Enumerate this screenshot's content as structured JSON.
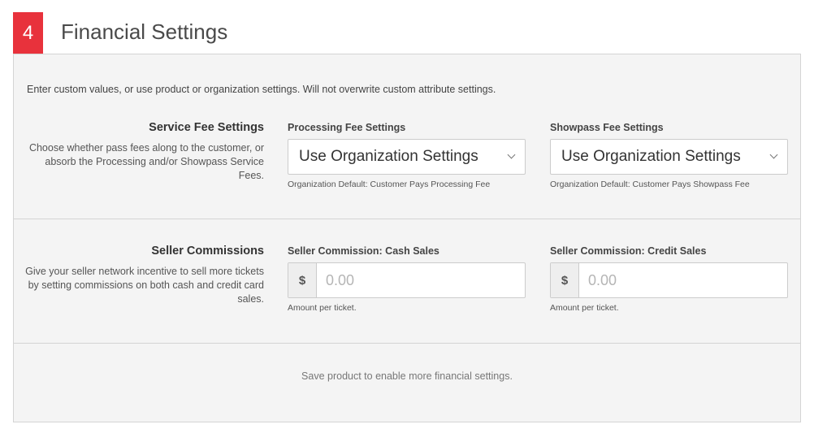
{
  "header": {
    "step_number": "4",
    "title": "Financial Settings"
  },
  "intro": "Enter custom values, or use product or organization settings. Will not overwrite custom attribute settings.",
  "service_fee": {
    "title": "Service Fee Settings",
    "description": "Choose whether pass fees along to the customer, or absorb the Processing and/or Showpass Service Fees.",
    "processing": {
      "label": "Processing Fee Settings",
      "selected": "Use Organization Settings",
      "hint": "Organization Default: Customer Pays Processing Fee"
    },
    "showpass": {
      "label": "Showpass Fee Settings",
      "selected": "Use Organization Settings",
      "hint": "Organization Default: Customer Pays Showpass Fee"
    }
  },
  "seller_commissions": {
    "title": "Seller Commissions",
    "description": "Give your seller network incentive to sell more tickets by setting commissions on both cash and credit card sales.",
    "cash": {
      "label": "Seller Commission: Cash Sales",
      "prefix": "$",
      "placeholder": "0.00",
      "value": "",
      "hint": "Amount per ticket."
    },
    "credit": {
      "label": "Seller Commission: Credit Sales",
      "prefix": "$",
      "placeholder": "0.00",
      "value": "",
      "hint": "Amount per ticket."
    }
  },
  "footer_note": "Save product to enable more financial settings.",
  "colors": {
    "accent": "#e8323c",
    "panel_bg": "#f4f4f4",
    "border": "#d4d4d4"
  }
}
